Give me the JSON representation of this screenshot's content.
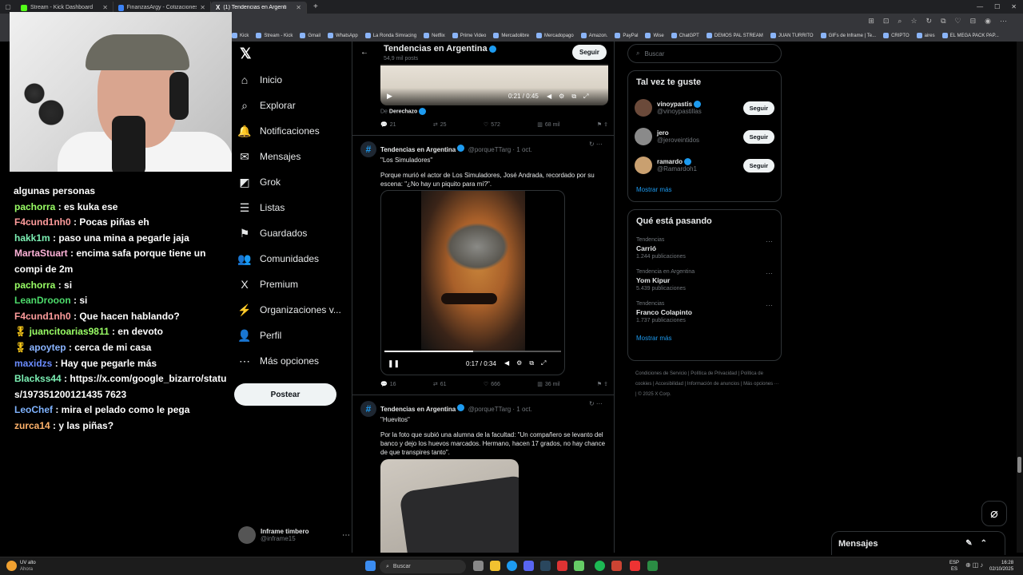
{
  "browser": {
    "tabs": [
      {
        "label": "Stream - Kick Dashboard",
        "color": "#53fc18"
      },
      {
        "label": "FinanzasArgy - Cotizaciones en ti",
        "color": "#3b82f6"
      },
      {
        "label": "(1) Tendencias en Argentina",
        "color": "#ffffff"
      }
    ],
    "new_tab": "+",
    "bookmarks": [
      "Kick",
      "Stream - Kick",
      "Gmail",
      "WhatsApp",
      "La Ronda Simracing",
      "Netflix",
      "Prime Video",
      "Mercadolibre",
      "Mercadopago",
      "Amazon.",
      "PayPal",
      "Wise",
      "ChatGPT",
      "DEMOS PAL STREAM",
      "JUAN TURRITO",
      "GIFs de Inframe | Te...",
      "CRIPTO",
      "aires",
      "EL MEGA PACK PAP..."
    ]
  },
  "chat": {
    "messages": [
      {
        "user": "",
        "text": "algunas personas",
        "color": "#ffffff"
      },
      {
        "user": "pachorra",
        "text": " : es kuka ese",
        "color": "#9aff66"
      },
      {
        "user": "F4cund1nh0",
        "text": " : Pocas piñas eh",
        "color": "#ff9c9c"
      },
      {
        "user": "hakk1m",
        "text": " : paso una mina a pegarle jaja",
        "color": "#7cf0b4"
      },
      {
        "user": "MartaStuart",
        "text": " : encima safa porque tiene un compi de 2m",
        "color": "#ffb3d9"
      },
      {
        "user": "pachorra",
        "text": " : si",
        "color": "#9aff66"
      },
      {
        "user": "LeanDrooon",
        "text": " : si",
        "color": "#4ddb6b"
      },
      {
        "user": "F4cund1nh0",
        "text": " : Que hacen hablando?",
        "color": "#ff9c9c"
      },
      {
        "user": "juancitoarias9811",
        "text": " : en devoto",
        "color": "#9aff66",
        "badge": true
      },
      {
        "user": "apoytep",
        "text": " : cerca de mi casa",
        "color": "#8ab4ff",
        "badge": true
      },
      {
        "user": "maxidzs",
        "text": " : Hay que pegarle más",
        "color": "#6b8cff"
      },
      {
        "user": "Blackss44",
        "text": " : https://x.com/google_bizarro/status/197351200121435 7623",
        "color": "#7cf0b4"
      },
      {
        "user": "LeoChef",
        "text": " : mira el pelado como le pega",
        "color": "#7fb3ff"
      },
      {
        "user": "zurca14",
        "text": " : y las piñas?",
        "color": "#ffb36b"
      }
    ]
  },
  "nav": {
    "items": [
      {
        "label": "Inicio",
        "icon": "⌂",
        "name": "home-icon"
      },
      {
        "label": "Explorar",
        "icon": "⌕",
        "name": "search-icon"
      },
      {
        "label": "Notificaciones",
        "icon": "🔔",
        "name": "bell-icon"
      },
      {
        "label": "Mensajes",
        "icon": "✉",
        "name": "mail-icon"
      },
      {
        "label": "Grok",
        "icon": "◩",
        "name": "grok-icon"
      },
      {
        "label": "Listas",
        "icon": "☰",
        "name": "list-icon"
      },
      {
        "label": "Guardados",
        "icon": "⚑",
        "name": "bookmark-icon"
      },
      {
        "label": "Comunidades",
        "icon": "👥",
        "name": "communities-icon"
      },
      {
        "label": "Premium",
        "icon": "X",
        "name": "premium-icon"
      },
      {
        "label": "Organizaciones v...",
        "icon": "⚡",
        "name": "lightning-icon"
      },
      {
        "label": "Perfil",
        "icon": "👤",
        "name": "profile-icon"
      },
      {
        "label": "Más opciones",
        "icon": "⋯",
        "name": "more-icon"
      }
    ],
    "post_label": "Postear",
    "account_name": "Inframe timbero",
    "account_handle": "@inframe15"
  },
  "feed": {
    "title": "Tendencias en Argentina",
    "subtitle": "54,9 mil posts",
    "follow_label": "Seguir",
    "video1_time": "0:21 / 0:45",
    "from_label": "De",
    "from_name": "Derechazo",
    "tweet0_stats": {
      "replies": "21",
      "reposts": "25",
      "likes": "572",
      "views": "68 mil"
    },
    "tweet1": {
      "name": "Tendencias en Argentina",
      "handle": "@porqueTTarg · 1 oct.",
      "title": "\"Los Simuladores\"",
      "text": "Porque murió el actor de Los Simuladores, José Andrada, recordado por su escena: \"¿No hay un piquito para mí?\".",
      "video_time": "0:17 / 0:34",
      "video_progress": 0.5,
      "stats": {
        "replies": "16",
        "reposts": "61",
        "likes": "666",
        "views": "36 mil"
      }
    },
    "tweet2": {
      "name": "Tendencias en Argentina",
      "handle": "@porqueTTarg · 1 oct.",
      "title": "\"Huevitos\"",
      "text": "Por la foto que subió una alumna de la facultad: \"Un compañero se levanto del banco y dejo los huevos marcados. Hermano, hacen 17 grados, no hay chance de que transpires tanto\"."
    }
  },
  "right": {
    "search_placeholder": "Buscar",
    "who_title": "Tal vez te guste",
    "who": [
      {
        "name": "vinoypastis",
        "handle": "@vinoypastillas",
        "verified": true
      },
      {
        "name": "jero",
        "handle": "@jeroveintidos",
        "verified": false
      },
      {
        "name": "ramardo",
        "handle": "@Ramardoh1",
        "verified": true
      }
    ],
    "follow_label": "Seguir",
    "show_more": "Mostrar más",
    "trends_title": "Qué está pasando",
    "trends": [
      {
        "context": "Tendencias",
        "name": "Carrió",
        "count": "1.244 publicaciones"
      },
      {
        "context": "Tendencia en Argentina",
        "name": "Yom Kipur",
        "count": "5.439 publicaciones"
      },
      {
        "context": "Tendencias",
        "name": "Franco Colapinto",
        "count": "1.737 publicaciones"
      }
    ],
    "footer": [
      "Condiciones de Servicio",
      "Política de Privacidad",
      "Política de cookies",
      "Accesibilidad",
      "Información de anuncios",
      "Más opciones ···",
      "© 2025 X Corp."
    ],
    "messages_label": "Mensajes"
  },
  "taskbar": {
    "weather": "UV alto",
    "weather_sub": "Ahora",
    "search": "Buscar",
    "lang": "ESP",
    "lang_sub": "ES",
    "time": "16:28",
    "date": "02/10/2025"
  }
}
